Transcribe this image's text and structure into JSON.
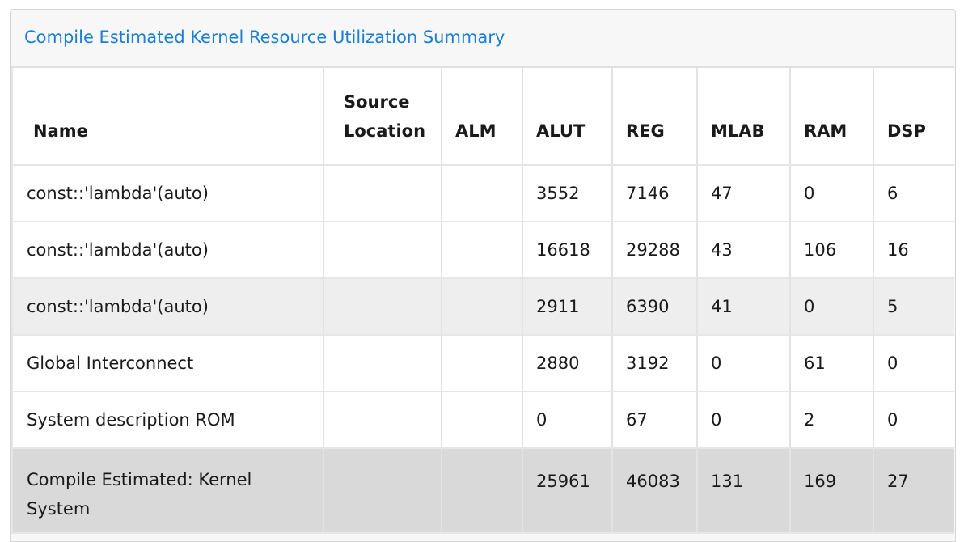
{
  "panel": {
    "title": "Compile Estimated Kernel Resource Utilization Summary"
  },
  "table": {
    "headers": {
      "name": "Name",
      "source_location": "Source Location",
      "alm": "ALM",
      "alut": "ALUT",
      "reg": "REG",
      "mlab": "MLAB",
      "ram": "RAM",
      "dsp": "DSP"
    },
    "rows": [
      {
        "name": "const::'lambda'(auto)",
        "source_location": "",
        "alm": "",
        "alut": "3552",
        "reg": "7146",
        "mlab": "47",
        "ram": "0",
        "dsp": "6"
      },
      {
        "name": "const::'lambda'(auto)",
        "source_location": "",
        "alm": "",
        "alut": "16618",
        "reg": "29288",
        "mlab": "43",
        "ram": "106",
        "dsp": "16"
      },
      {
        "name": "const::'lambda'(auto)",
        "source_location": "",
        "alm": "",
        "alut": "2911",
        "reg": "6390",
        "mlab": "41",
        "ram": "0",
        "dsp": "5"
      },
      {
        "name": "Global Interconnect",
        "source_location": "",
        "alm": "",
        "alut": "2880",
        "reg": "3192",
        "mlab": "0",
        "ram": "61",
        "dsp": "0"
      },
      {
        "name": "System description ROM",
        "source_location": "",
        "alm": "",
        "alut": "0",
        "reg": "67",
        "mlab": "0",
        "ram": "2",
        "dsp": "0"
      }
    ],
    "total": {
      "name": "Compile Estimated: Kernel System",
      "source_location": "",
      "alm": "",
      "alut": "25961",
      "reg": "46083",
      "mlab": "131",
      "ram": "169",
      "dsp": "27"
    }
  },
  "colors": {
    "title": "#1a7fd4",
    "header_bg": "#f7f7f7",
    "row_shaded": "#eeeeee",
    "row_total": "#d9d9d9"
  }
}
